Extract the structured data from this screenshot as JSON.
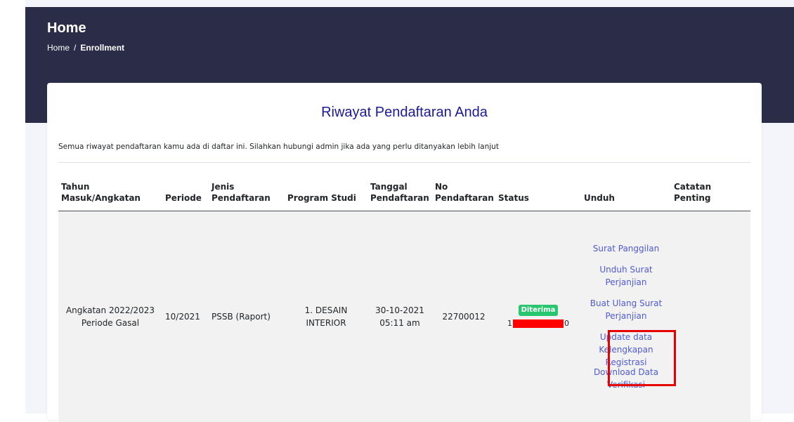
{
  "header": {
    "title": "Home",
    "breadcrumb": {
      "home": "Home",
      "separator": "/",
      "current": "Enrollment"
    }
  },
  "card": {
    "title": "Riwayat Pendaftaran Anda",
    "description": "Semua riwayat pendaftaran kamu ada di daftar ini. Silahkan hubungi admin jika ada yang perlu ditanyakan lebih lanjut"
  },
  "table": {
    "headers": {
      "tahun_1": "Tahun",
      "tahun_2": "Masuk/Angkatan",
      "periode": "Periode",
      "jenis_1": "Jenis",
      "jenis_2": "Pendaftaran",
      "program": "Program Studi",
      "tanggal_1": "Tanggal",
      "tanggal_2": "Pendaftaran",
      "no_1": "No",
      "no_2": "Pendaftaran",
      "status": "Status",
      "unduh": "Unduh",
      "catatan_1": "Catatan",
      "catatan_2": "Penting"
    },
    "row": {
      "angkatan_1": "Angkatan 2022/2023",
      "angkatan_2": "Periode Gasal",
      "periode": "10/2021",
      "jenis": "PSSB (Raport)",
      "program_1": "1. DESAIN",
      "program_2": "INTERIOR",
      "tanggal_1": "30-10-2021",
      "tanggal_2": "05:11 am",
      "no_pendaftaran": "22700012",
      "status_badge": "Diterima",
      "phone_prefix": "1",
      "phone_suffix": "0",
      "downloads": {
        "surat_panggilan": "Surat Panggilan",
        "unduh_surat_1": "Unduh Surat",
        "unduh_surat_2": "Perjanjian",
        "buat_ulang_1": "Buat Ulang Surat",
        "buat_ulang_2": "Perjanjian",
        "update_1": "Update data",
        "update_2": "Kelengkapan",
        "update_3": "Registrasi",
        "download_1": "Download Data",
        "download_2": "Verifikasi"
      }
    }
  },
  "colors": {
    "header_bg": "#2b2d48",
    "title_color": "#1a1a9a",
    "link_color": "#4f5bd5",
    "badge_bg": "#28c76f",
    "highlight": "#e60000",
    "redaction": "#ff0000"
  }
}
